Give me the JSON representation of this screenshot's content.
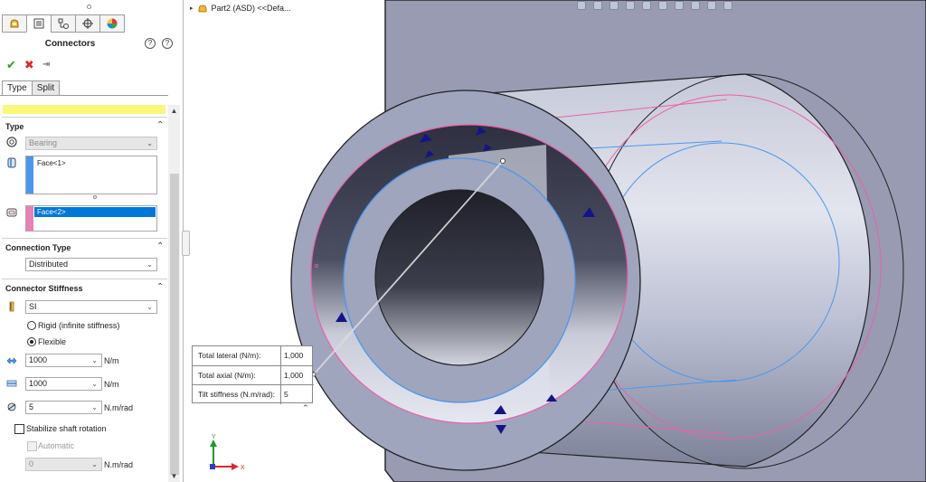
{
  "panel": {
    "title": "Connectors",
    "tabs": [
      {
        "icon": "feature-manager-icon"
      },
      {
        "icon": "property-manager-icon"
      },
      {
        "icon": "configuration-manager-icon"
      },
      {
        "icon": "dimxpert-icon"
      },
      {
        "icon": "display-manager-icon"
      }
    ],
    "sub_tabs": [
      "Type",
      "Split"
    ],
    "type_section": {
      "heading": "Type",
      "connector_type": "Bearing",
      "selection_1": "Face<1>",
      "selection_2": "Face<2>"
    },
    "connection_type": {
      "heading": "Connection Type",
      "value": "Distributed"
    },
    "stiffness": {
      "heading": "Connector Stiffness",
      "unit_system": "SI",
      "rigid_label": "Rigid (infinite stiffness)",
      "flexible_label": "Flexible",
      "flexible_selected": true,
      "lateral_value": "1000",
      "lateral_unit": "N/m",
      "axial_value": "1000",
      "axial_unit": "N/m",
      "tilt_value": "5",
      "tilt_unit": "N.m/rad",
      "stabilize_label": "Stabilize shaft rotation",
      "automatic_label": "Automatic",
      "rotation_value": "0",
      "rotation_unit": "N.m/rad"
    }
  },
  "viewport": {
    "tree_label": "Part2 (ASD) <<Defa...",
    "callout": [
      {
        "key": "Total lateral (N/m):",
        "value": "1,000"
      },
      {
        "key": "Total axial (N/m):",
        "value": "1,000"
      },
      {
        "key": "Tilt stiffness (N.m/rad):",
        "value": "5"
      }
    ],
    "axis_x": "X",
    "axis_y": "Y"
  },
  "colors": {
    "model_body": "#b9bdd1",
    "model_face": "#9fa5bd",
    "selection_blue": "#4a98f0",
    "selection_pink": "#ee5fa8",
    "arrow": "#14148a"
  }
}
